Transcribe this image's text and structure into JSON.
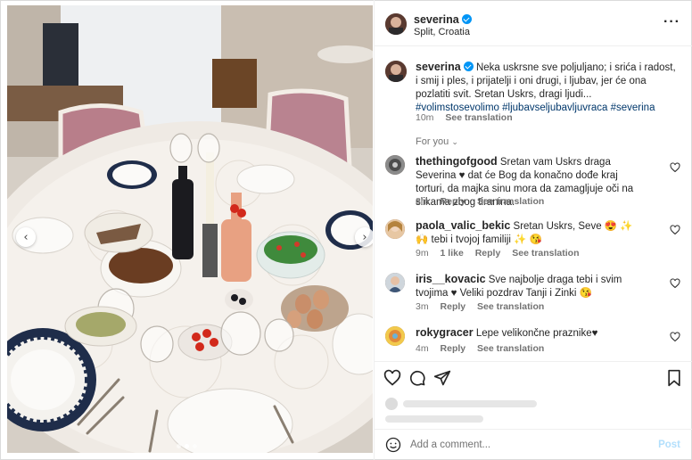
{
  "post": {
    "author": "severina",
    "location": "Split, Croatia",
    "more_icon": "more-horizontal-icon"
  },
  "caption": {
    "username": "severina",
    "text": "Neka uskrsne sve poljuljano; i srića i radost, i smij i ples, i prijatelji i oni drugi, i ljubav, jer će ona pozlatiti svit. Sretan Uskrs, dragi ljudi...",
    "hashtags": "#volimstosevolimo #ljubavseljubavljuvraca #severina",
    "time": "10m",
    "see_translation": "See translation"
  },
  "for_you": "For you",
  "comments": [
    {
      "username": "thethingofgood",
      "text": "Sretan vam Uskrs draga Severina ♥ dat će Bog da konačno dođe kraj torturi, da majka sinu mora da zamagljuje oči na slikama zbog tiranina.",
      "time": "8m",
      "reply": "Reply",
      "likes": "",
      "see_translation": "See translation"
    },
    {
      "username": "paola_valic_bekic",
      "text": "Sretan Uskrs, Seve 😍 ✨ 🙌 tebi i tvojoj familiji ✨ 😘",
      "time": "9m",
      "reply": "Reply",
      "likes": "1 like",
      "see_translation": "See translation"
    },
    {
      "username": "iris__kovacic",
      "text": "Sve najbolje draga tebi i svim tvojima ♥ Veliki pozdrav Tanji i Zinki 😘",
      "time": "3m",
      "reply": "Reply",
      "likes": "",
      "see_translation": "See translation"
    },
    {
      "username": "rokygracer",
      "text": "Lepe velikončne praznike♥",
      "time": "4m",
      "reply": "Reply",
      "likes": "",
      "see_translation": "See translation"
    }
  ],
  "composer": {
    "placeholder": "Add a comment...",
    "post_label": "Post"
  },
  "colors": {
    "link": "#00376b",
    "verified": "#0095f6",
    "muted": "#737373",
    "heart_red": "#ed4956"
  }
}
